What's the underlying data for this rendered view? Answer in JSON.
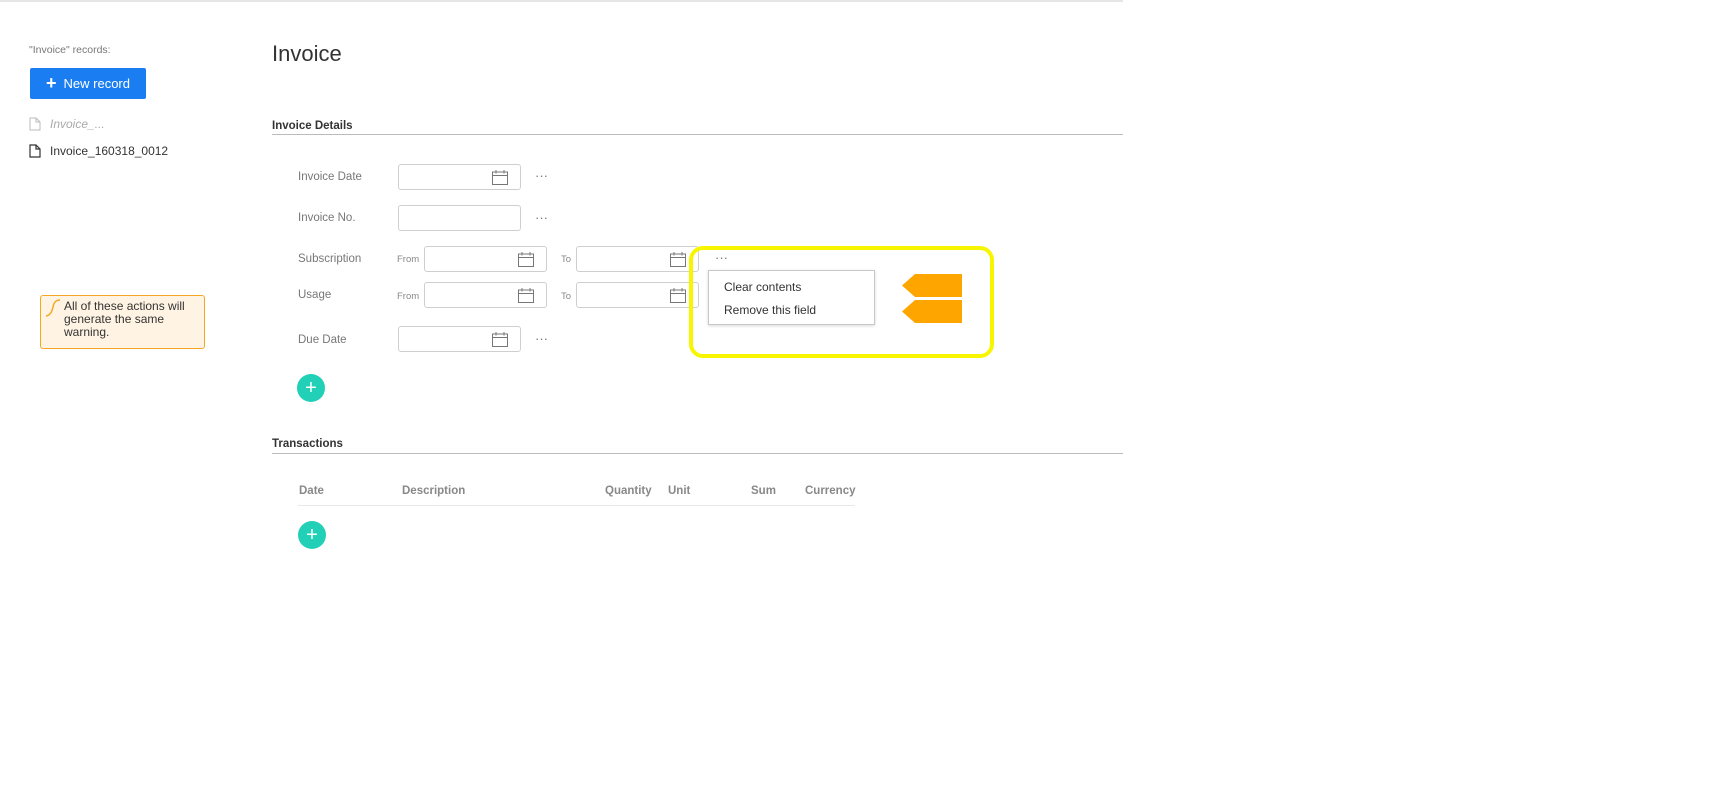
{
  "sidebar": {
    "caption": "\"Invoice\" records:",
    "new_record_label": "New record",
    "records": [
      "Invoice_...",
      "Invoice_160318_0012"
    ]
  },
  "note": {
    "text": "All of these actions will generate the same warning."
  },
  "main": {
    "title": "Invoice",
    "details_section": "Invoice Details",
    "fields": {
      "invoice_date": "Invoice Date",
      "invoice_no": "Invoice No.",
      "subscription": "Subscription",
      "usage": "Usage",
      "due_date": "Due Date"
    },
    "range_from": "From",
    "range_to": "To",
    "more_glyph": "···",
    "transactions_section": "Transactions",
    "columns": [
      "Date",
      "Description",
      "Quantity",
      "Unit",
      "Sum",
      "Currency"
    ]
  },
  "context_menu": {
    "items": [
      "Clear contents",
      "Remove this field"
    ]
  },
  "icons": {
    "add": "plus-icon",
    "date": "calendar-icon",
    "record": "document-icon"
  },
  "colors": {
    "primary": "#1a7ef2",
    "add_button": "#21d0b7",
    "highlight": "#f7f600",
    "arrow": "#ffa500",
    "note_border": "#f5a623",
    "note_bg": "#fff4e3"
  }
}
